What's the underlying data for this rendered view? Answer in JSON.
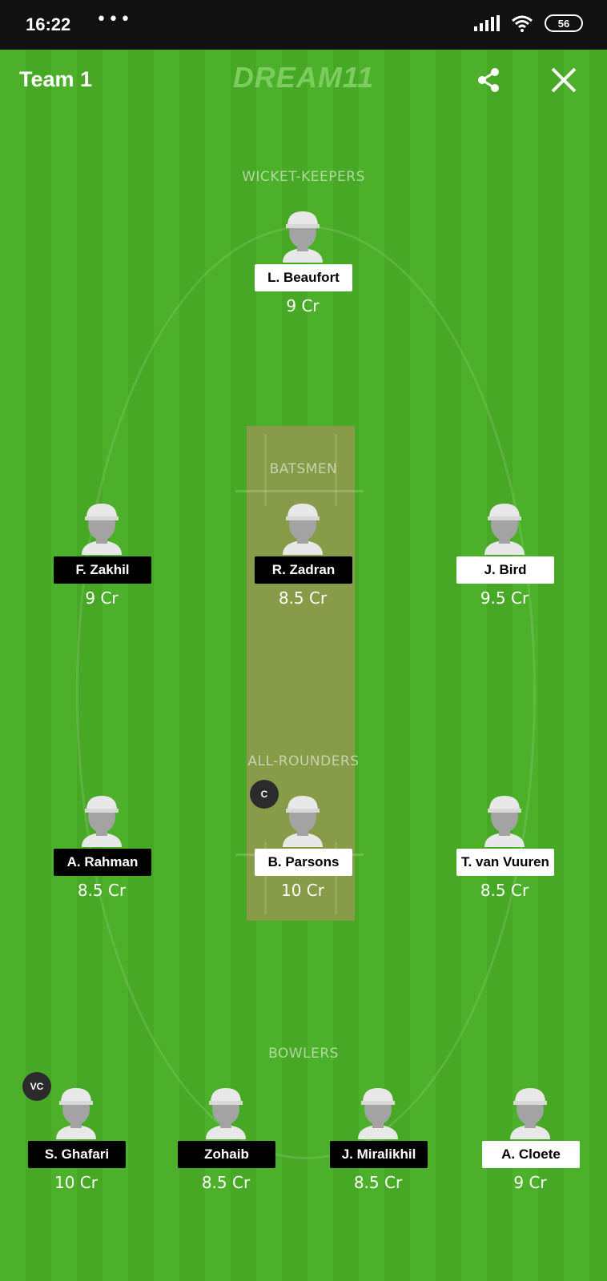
{
  "status_bar": {
    "time": "16:22",
    "dots": "•••",
    "battery": "56"
  },
  "header": {
    "title": "Team 1",
    "logo": "DREAM11",
    "share_icon": "share-icon",
    "close_icon": "close-icon"
  },
  "sections": {
    "wicket_keepers": "WICKET-KEEPERS",
    "batsmen": "BATSMEN",
    "all_rounders": "ALL-ROUNDERS",
    "bowlers": "BOWLERS"
  },
  "players": {
    "wk": [
      {
        "name": "L. Beaufort",
        "credits": "9 Cr"
      }
    ],
    "bat": [
      {
        "name": "F. Zakhil",
        "credits": "9 Cr"
      },
      {
        "name": "R. Zadran",
        "credits": "8.5 Cr"
      },
      {
        "name": "J. Bird",
        "credits": "9.5 Cr"
      }
    ],
    "ar": [
      {
        "name": "A. Rahman",
        "credits": "8.5 Cr"
      },
      {
        "name": "B. Parsons",
        "credits": "10 Cr",
        "badge": "C"
      },
      {
        "name": "T. van Vuuren",
        "credits": "8.5 Cr"
      }
    ],
    "bowl": [
      {
        "name": "S. Ghafari",
        "credits": "10 Cr",
        "badge": "VC"
      },
      {
        "name": "Zohaib",
        "credits": "8.5 Cr"
      },
      {
        "name": "J. Miralikhil",
        "credits": "8.5 Cr"
      },
      {
        "name": "A. Cloete",
        "credits": "9 Cr"
      }
    ]
  },
  "colors": {
    "field": "#4aab28",
    "pitch": "#889b48",
    "dark_tag": "#000000",
    "light_tag": "#ffffff"
  }
}
